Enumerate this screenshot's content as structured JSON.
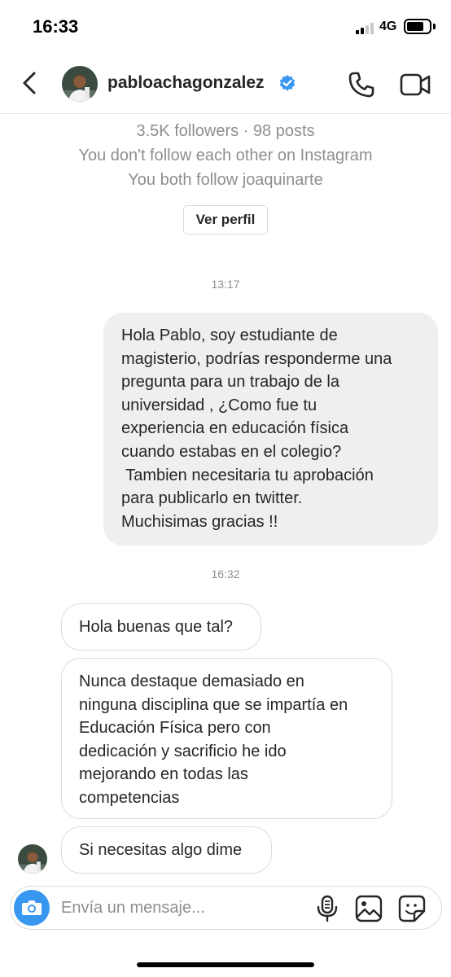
{
  "status_bar": {
    "time": "16:33",
    "network": "4G"
  },
  "header": {
    "username": "pabloachagonzalez",
    "verified": true
  },
  "profile": {
    "followers_posts": "3.5K followers · 98 posts",
    "follow_status": "You don't follow each other on Instagram",
    "mutual": "You both follow joaquinarte",
    "view_profile_label": "Ver perfil"
  },
  "thread": [
    {
      "timestamp": "13:17",
      "sent": {
        "lines": [
          "Hola Pablo, soy estudiante de",
          "magisterio, podrías responderme una",
          "pregunta para un trabajo de la",
          "universidad , ¿Como fue tu",
          "experiencia en educación física",
          "cuando estabas en el colegio?",
          " Tambien necesitaria tu aprobación",
          "para publicarlo en twitter.",
          "Muchisimas gracias !!"
        ]
      }
    },
    {
      "timestamp": "16:32",
      "received": [
        {
          "text": "Hola buenas que tal?"
        },
        {
          "lines": [
            "Nunca destaque demasiado en",
            "ninguna disciplina que se impartía en",
            "Educación Física pero con",
            "dedicación y sacrificio he ido",
            "mejorando en todas las",
            "competencias"
          ]
        },
        {
          "text": "Si necesitas algo dime"
        }
      ]
    }
  ],
  "composer": {
    "placeholder": "Envía un mensaje..."
  },
  "icons": {
    "back": "chevron-left-icon",
    "verified": "verified-badge-icon",
    "call": "phone-icon",
    "video": "video-camera-icon",
    "camera": "camera-icon",
    "mic": "microphone-icon",
    "gallery": "image-icon",
    "sticker": "sticker-icon"
  },
  "colors": {
    "accent": "#3897f0",
    "sent_bubble": "#efefef",
    "secondary_text": "#8e8e8e"
  }
}
